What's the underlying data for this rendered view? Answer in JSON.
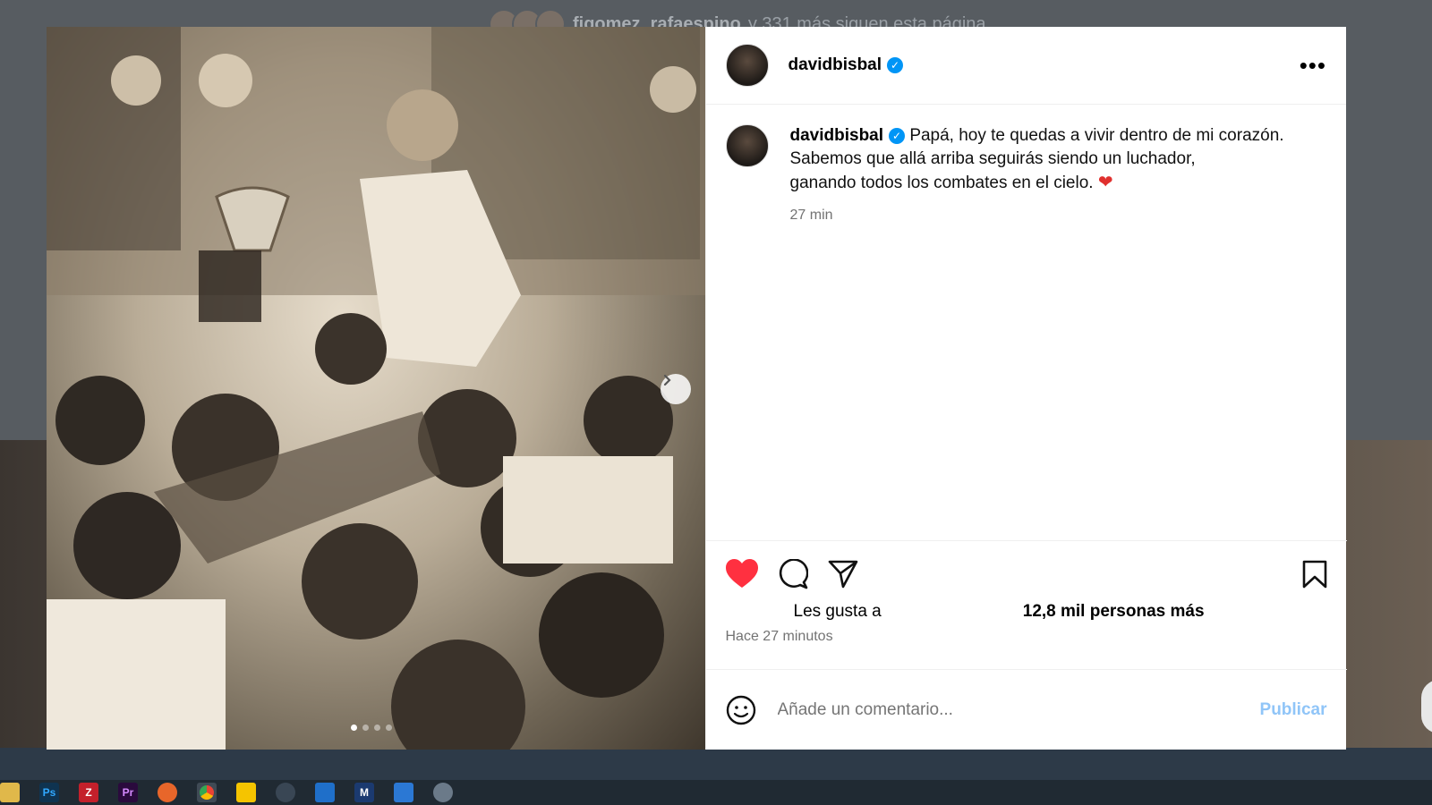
{
  "background": {
    "follow_names": "figomez, rafaespino",
    "follow_rest": "y 331 más siguen esta página"
  },
  "post": {
    "username": "davidbisbal",
    "caption_line1": "Papá, hoy te quedas a vivir dentro de mi corazón.",
    "caption_line2": "Sabemos que allá arriba seguirás siendo un luchador,",
    "caption_line3": "ganando todos los combates en el cielo.",
    "caption_emoji": "❤",
    "caption_time": "27 min",
    "likes_prefix": "Les gusta a",
    "likes_rest": "12,8 mil personas más",
    "posted_ago": "Hace 27 minutos",
    "comment_placeholder": "Añade un comentario...",
    "publish_label": "Publicar",
    "carousel_index": 1,
    "carousel_count": 4
  },
  "colors": {
    "like_red": "#ff3040",
    "verified_blue": "#0095f6",
    "publish_blue": "#90c5f8"
  },
  "taskbar": [
    "explorer-icon",
    "photoshop-icon",
    "filezilla-icon",
    "premiere-icon",
    "firefox-icon",
    "chrome-icon",
    "sticky-notes-icon",
    "screen-capture-icon",
    "outlook-icon",
    "maxthon-icon",
    "document-icon",
    "paint-icon"
  ],
  "taskbar_labels": {
    "photoshop": "Ps",
    "premiere": "Pr",
    "maxthon": "M"
  }
}
